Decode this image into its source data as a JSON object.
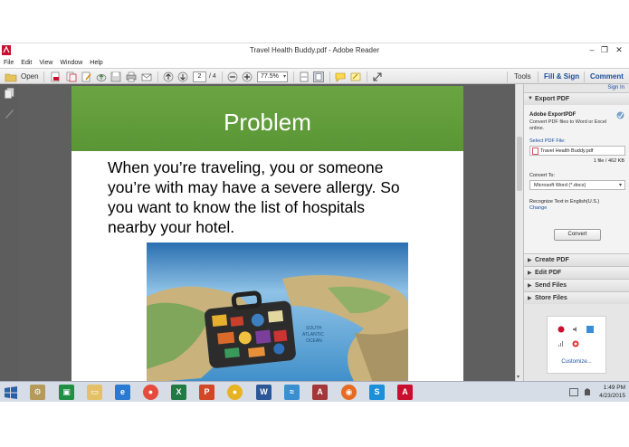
{
  "window": {
    "title": "Travel Health Buddy.pdf - Adobe Reader"
  },
  "menu": [
    "File",
    "Edit",
    "View",
    "Window",
    "Help"
  ],
  "toolbar": {
    "open_label": "Open",
    "page_current": "2",
    "page_total": "/ 4",
    "zoom": "77.5%",
    "tools_label": "Tools",
    "fillsign_label": "Fill & Sign",
    "comment_label": "Comment"
  },
  "slide": {
    "title": "Problem",
    "body": "When you’re traveling, you or someone\nyou’re with may have a severe allergy. So\nyou want to know the list of hospitals\nnearby your hotel.",
    "image_text": "SOUTH\nATLANTIC\nOCEAN"
  },
  "panel": {
    "signin": "Sign In",
    "export_header": "Export PDF",
    "export_title": "Adobe ExportPDF",
    "export_desc": "Convert PDF files to Word or Excel online.",
    "select_label": "Select PDF File:",
    "file_name": "Travel Health Buddy.pdf",
    "file_info": "1 file / 462 KB",
    "convert_to_label": "Convert To:",
    "convert_to_value": "Microsoft Word (*.docx)",
    "recognize_text": "Recognize Text in English(U.S.)",
    "change_link": "Change",
    "convert_button": "Convert",
    "sections": [
      "Create PDF",
      "Edit PDF",
      "Send Files",
      "Store Files"
    ]
  },
  "tray": {
    "customize": "Customize..."
  },
  "clock": {
    "time": "1:49 PM",
    "date": "4/23/2015"
  },
  "colors": {
    "slide_green": "#5f9b39",
    "link_blue": "#1b4fa0"
  }
}
